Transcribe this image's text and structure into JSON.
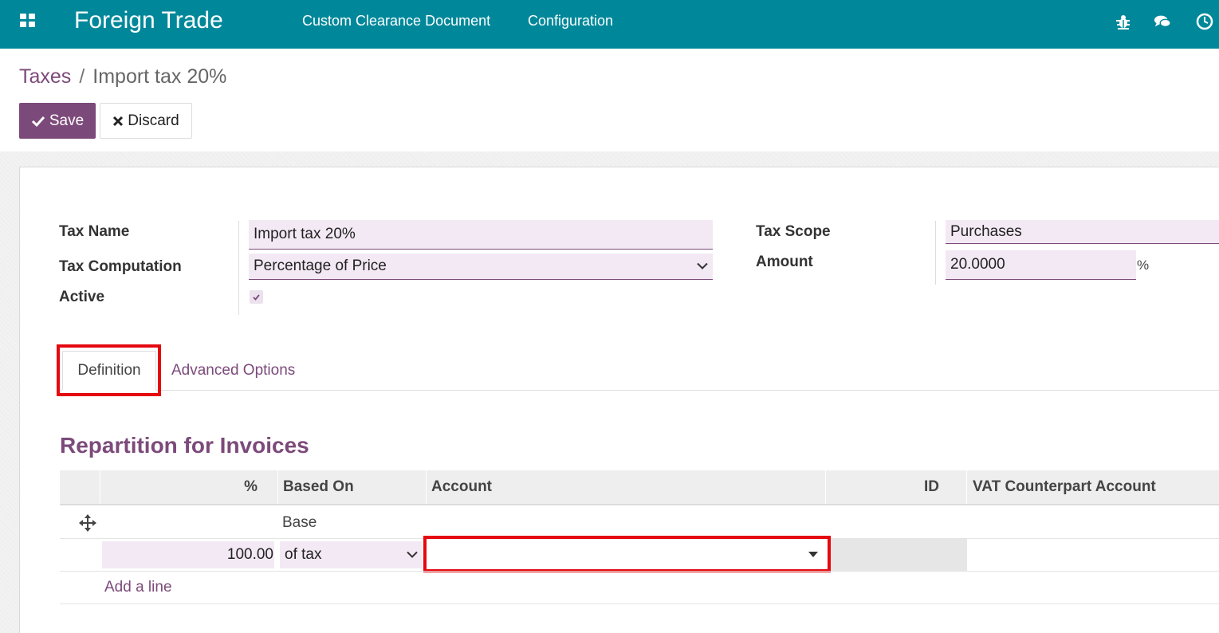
{
  "navbar": {
    "app_title": "Foreign Trade",
    "menu": [
      {
        "label": "Custom Clearance Document"
      },
      {
        "label": "Configuration"
      }
    ],
    "icons": [
      "apps-grid-icon",
      "bug-icon",
      "chat-icon",
      "clock-icon"
    ]
  },
  "breadcrumb": {
    "parent": "Taxes",
    "separator": "/",
    "current": "Import tax 20%"
  },
  "buttons": {
    "save": "Save",
    "discard": "Discard"
  },
  "form": {
    "tax_name_label": "Tax Name",
    "tax_name_value": "Import tax 20%",
    "tax_computation_label": "Tax Computation",
    "tax_computation_value": "Percentage of Price",
    "active_label": "Active",
    "active_checked": true,
    "tax_scope_label": "Tax Scope",
    "tax_scope_value": "Purchases",
    "amount_label": "Amount",
    "amount_value": "20.0000",
    "amount_unit": "%"
  },
  "tabs": [
    {
      "label": "Definition",
      "active": true
    },
    {
      "label": "Advanced Options",
      "active": false
    }
  ],
  "repartition": {
    "title": "Repartition for Invoices",
    "columns": [
      "%",
      "Based On",
      "Account",
      "ID",
      "VAT Counterpart Account"
    ],
    "rows": [
      {
        "percent": "",
        "based_on": "Base",
        "account": "",
        "id": "",
        "vat": ""
      },
      {
        "percent": "100.00",
        "based_on": "of tax",
        "account": "",
        "id": "",
        "vat": ""
      }
    ],
    "add_line": "Add a line"
  },
  "colors": {
    "navbar": "#00889a",
    "brand": "#7c4a7a",
    "highlight": "#e5080f"
  }
}
